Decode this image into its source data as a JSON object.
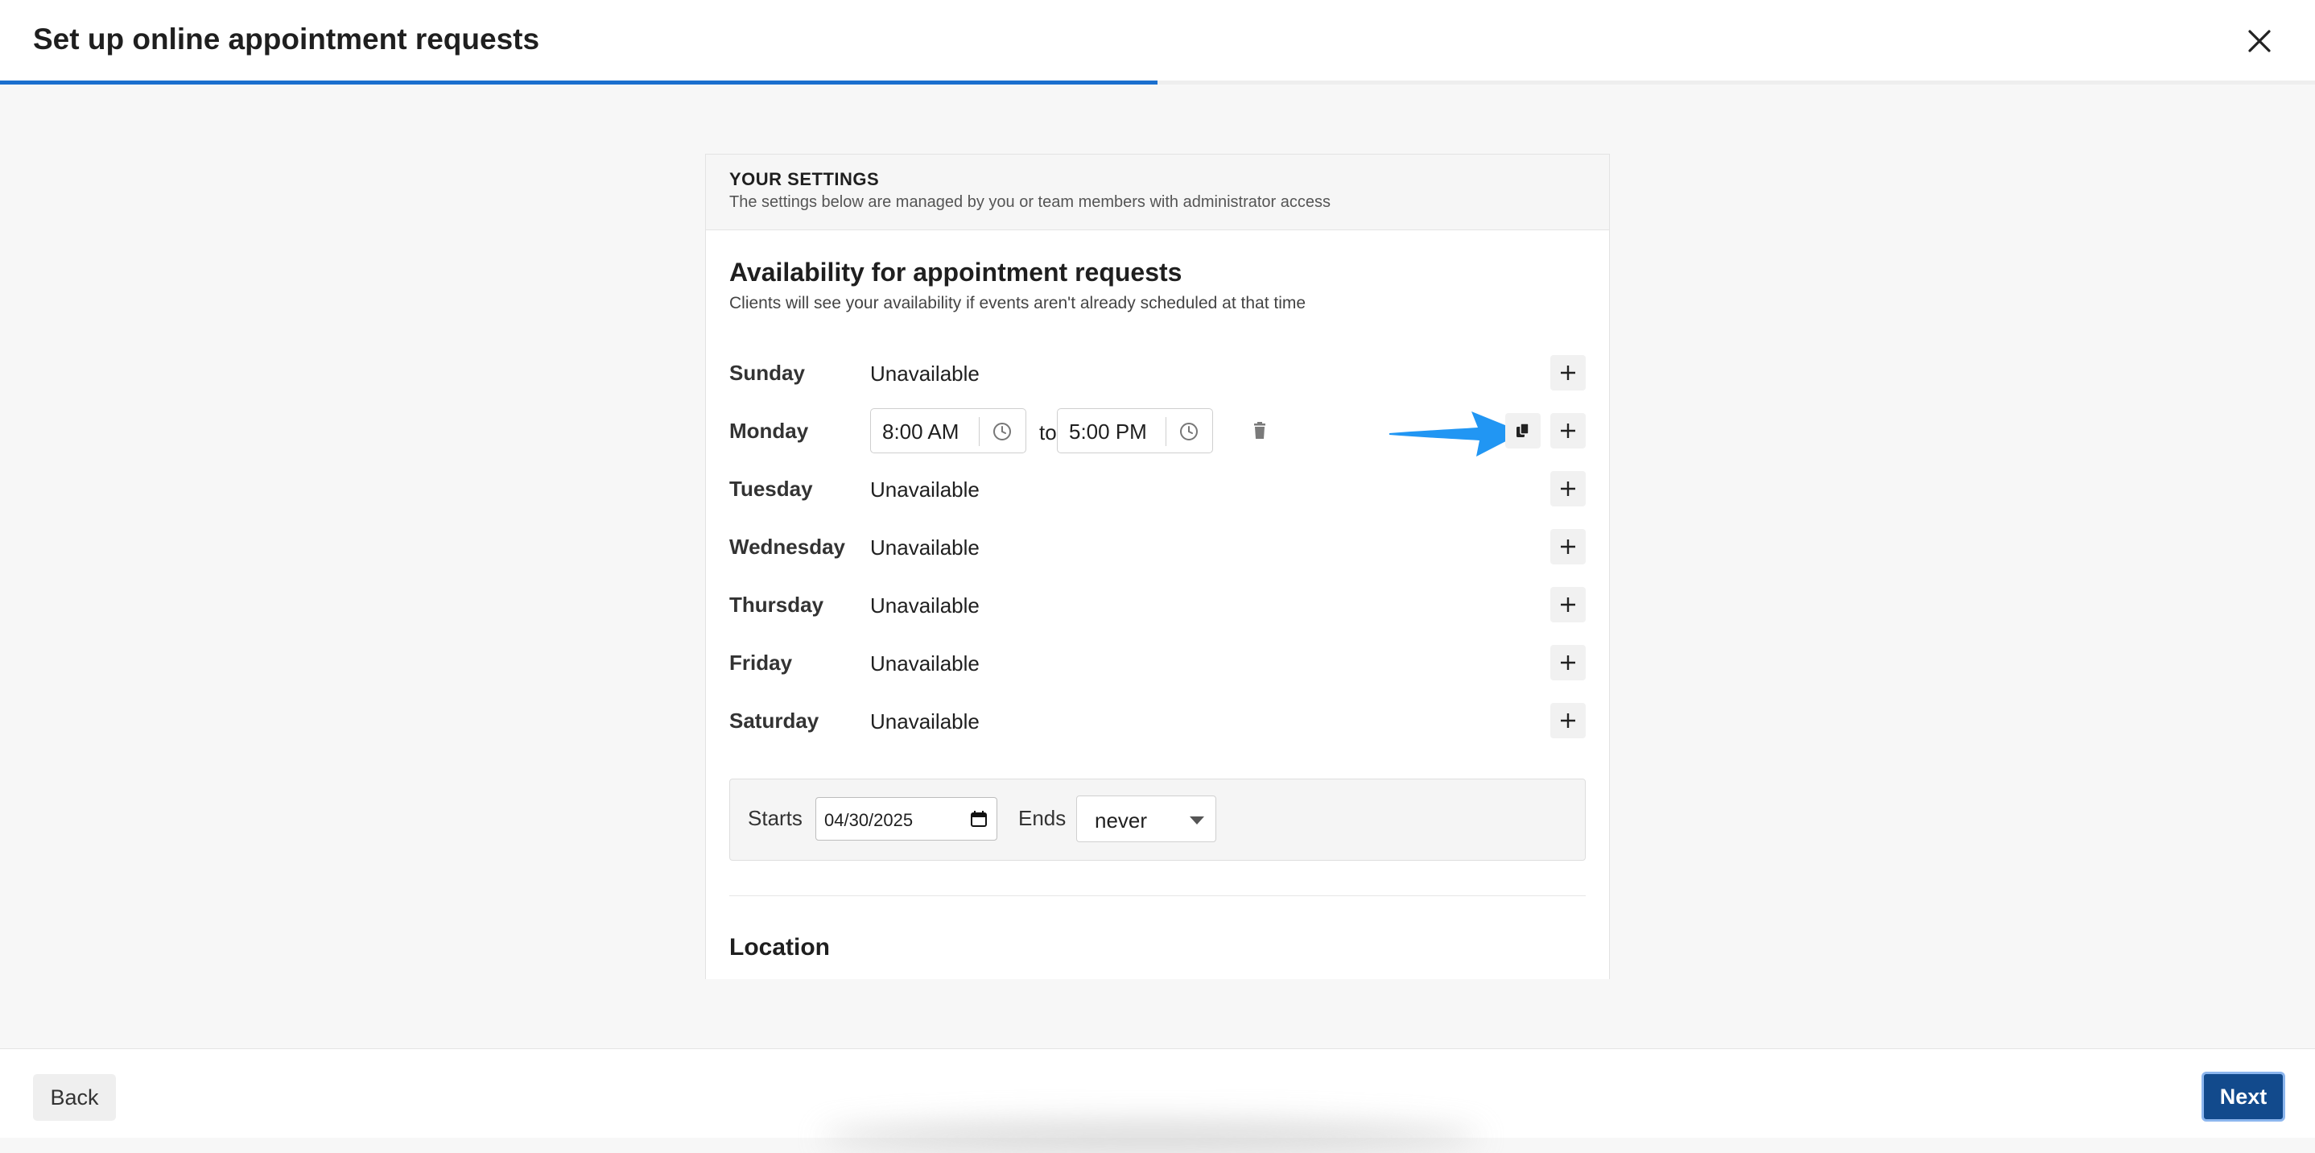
{
  "header": {
    "title": "Set up online appointment requests",
    "progress_fraction": 0.5
  },
  "card": {
    "settings_title": "YOUR SETTINGS",
    "settings_subtitle": "The settings below are managed by you or team members with administrator access",
    "section_title": "Availability for appointment requests",
    "section_subtitle": "Clients will see your availability if events aren't already scheduled at that time",
    "days": [
      {
        "name": "Sunday",
        "status": "Unavailable"
      },
      {
        "name": "Monday",
        "start": "8:00 AM",
        "to": "to",
        "end": "5:00 PM"
      },
      {
        "name": "Tuesday",
        "status": "Unavailable"
      },
      {
        "name": "Wednesday",
        "status": "Unavailable"
      },
      {
        "name": "Thursday",
        "status": "Unavailable"
      },
      {
        "name": "Friday",
        "status": "Unavailable"
      },
      {
        "name": "Saturday",
        "status": "Unavailable"
      }
    ],
    "range": {
      "starts_label": "Starts",
      "starts_value": "04/30/2025",
      "ends_label": "Ends",
      "ends_value": "never"
    },
    "location_title": "Location"
  },
  "footer": {
    "back_label": "Back",
    "next_label": "Next"
  },
  "colors": {
    "progress": "#1a6fce",
    "next_button": "#124a8c",
    "arrow": "#2196f3"
  },
  "icons": [
    "close-icon",
    "plus-icon",
    "clock-icon",
    "trash-icon",
    "copy-icon",
    "calendar-icon",
    "arrow-icon"
  ]
}
